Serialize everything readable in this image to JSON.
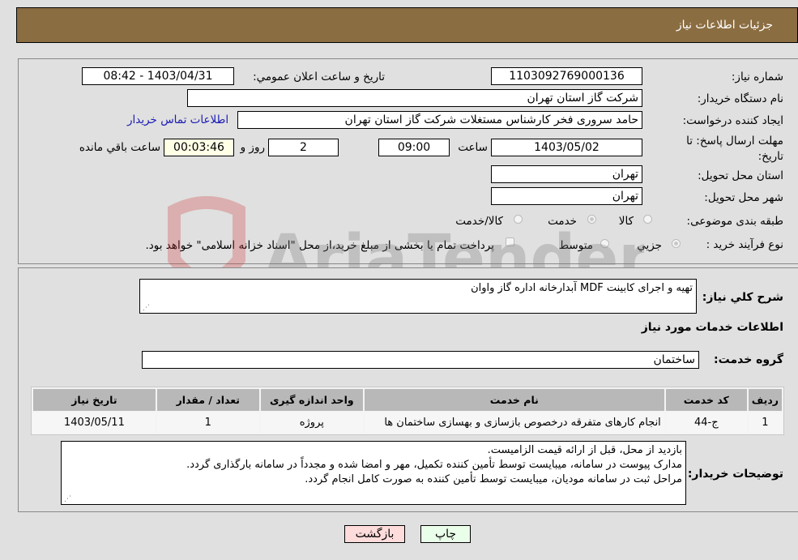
{
  "header": {
    "title": "جزئیات اطلاعات نیاز"
  },
  "form": {
    "need_number": {
      "label": "شماره نیاز:",
      "value": "1103092769000136"
    },
    "announce_datetime": {
      "label": "تاریخ و ساعت اعلان عمومي:",
      "value": "1403/04/31 - 08:42"
    },
    "buyer_org": {
      "label": "نام دستگاه خریدار:",
      "value": "شرکت گاز استان تهران"
    },
    "creator": {
      "label": "ایجاد کننده درخواست:",
      "value": "حامد سروری فخر کارشناس مستغلات شرکت گاز استان تهران"
    },
    "buyer_contact_link": "اطلاعات تماس خریدار",
    "deadline": {
      "label": "مهلت ارسال پاسخ: تا تاریخ:",
      "date": "1403/05/02",
      "time_label": "ساعت",
      "time": "09:00",
      "days": "2",
      "days_label": "روز و",
      "remaining": "00:03:46",
      "remaining_label": "ساعت باقي مانده"
    },
    "province": {
      "label": "استان محل تحویل:",
      "value": "تهران"
    },
    "city": {
      "label": "شهر محل تحویل:",
      "value": "تهران"
    },
    "category": {
      "label": "طبقه بندی موضوعی:",
      "options": [
        "کالا",
        "خدمت",
        "کالا/خدمت"
      ],
      "selected": "خدمت"
    },
    "purchase_type": {
      "label": "نوع فرآیند خرید :",
      "options": [
        "جزيي",
        "متوسط"
      ],
      "selected": "جزيي",
      "treasury_note": "پرداخت تمام یا بخشی از مبلغ خرید،از محل \"اسناد خزانه اسلامی\" خواهد بود."
    }
  },
  "details": {
    "description_label": "شرح كلي نياز:",
    "description": "تهیه و اجرای کابینت MDF آبدارخانه اداره گاز واوان",
    "services_heading": "اطلاعات خدمات مورد نياز",
    "service_group_label": "گروه خدمت:",
    "service_group": "ساختمان",
    "table": {
      "headers": [
        "رديف",
        "کد خدمت",
        "نام خدمت",
        "واحد اندازه گیری",
        "تعداد / مقدار",
        "تاریخ نیاز"
      ],
      "rows": [
        [
          "1",
          "ج-44",
          "انجام کارهای متفرقه درخصوص بازسازی و بهسازی ساختمان ها",
          "پروژه",
          "1",
          "1403/05/11"
        ]
      ]
    },
    "buyer_notes_label": "توضیحات خریدار:",
    "buyer_notes": [
      "بازدید از محل، قبل از ارائه قیمت الزامیست.",
      "مدارک پیوست در سامانه، میبایست توسط تأمین کننده تکمیل، مهر و امضا شده و مجدداً در سامانه بارگذاری گردد.",
      "مراحل ثبت در سامانه مودیان، میبایست توسط تأمین کننده به صورت کامل انجام گردد."
    ]
  },
  "buttons": {
    "print": "چاپ",
    "back": "بازگشت"
  },
  "watermark": "AriaTender.neT"
}
